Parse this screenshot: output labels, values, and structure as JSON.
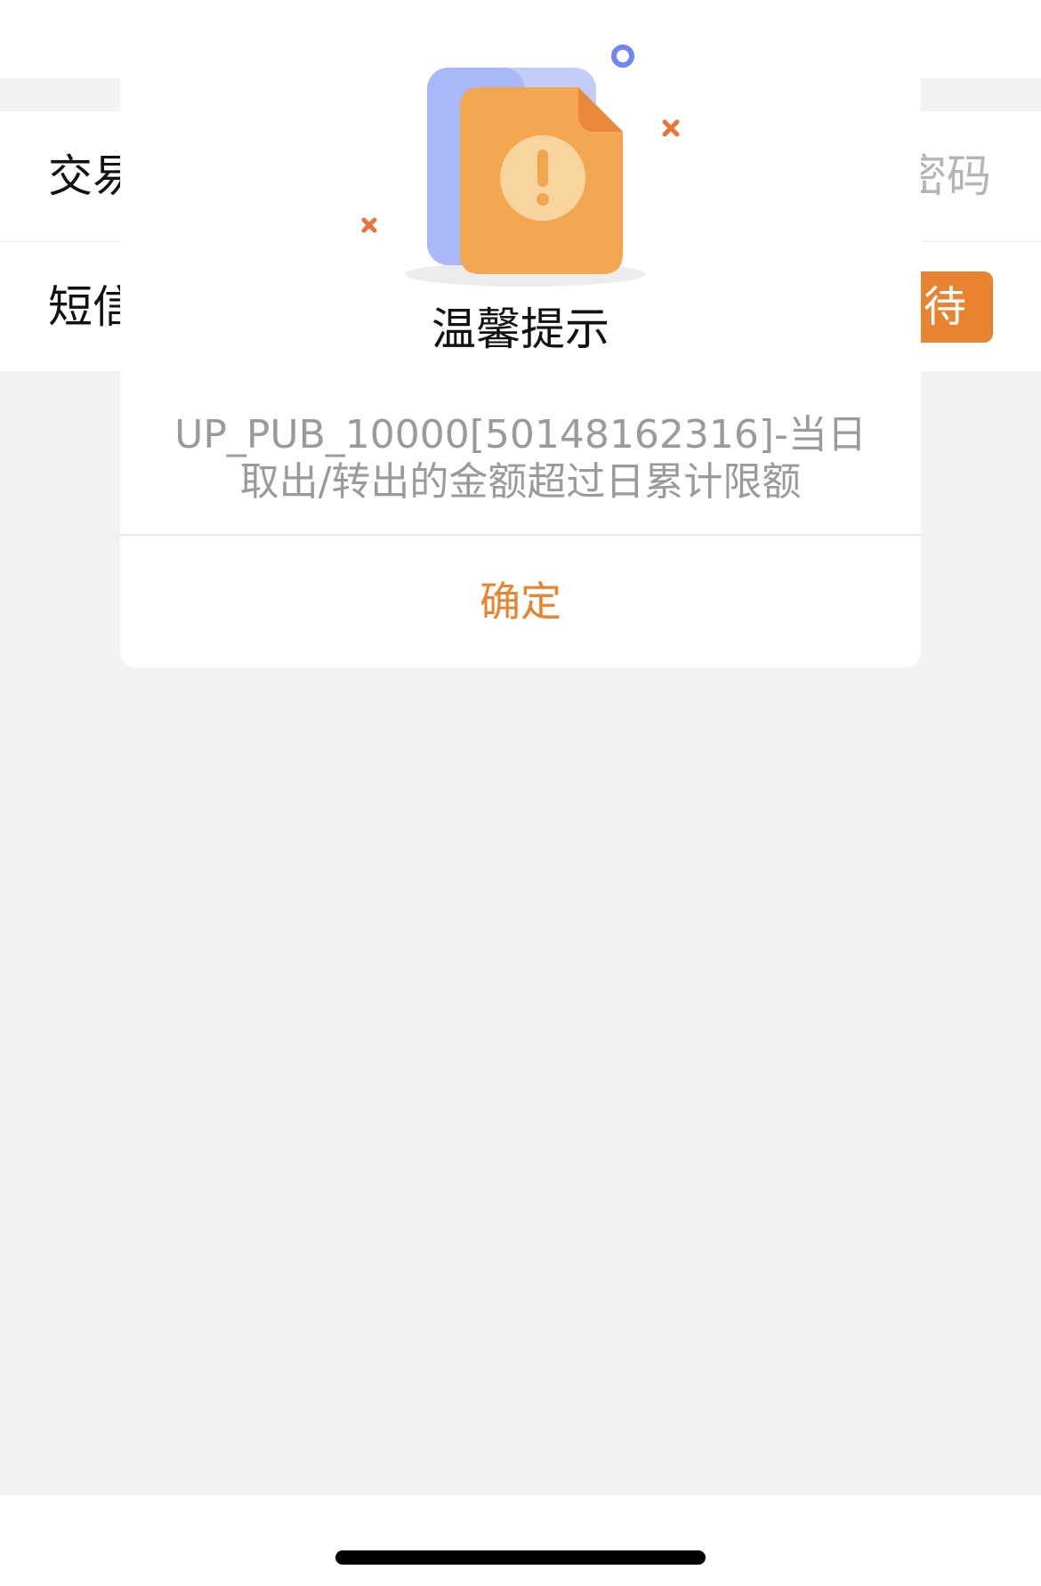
{
  "background_rows": {
    "row1_label": "交易",
    "row1_right": "密码",
    "row2_label": "短信",
    "row2_button": "待"
  },
  "dialog": {
    "title": "温馨提示",
    "message": "UP_PUB_10000[50148162316]-当日取出/转出的金额超过日累计限额",
    "confirm_label": "确定",
    "illustration_icon": "warning-document-icon"
  },
  "colors": {
    "accent": "#e8842f",
    "background": "#f2f2f2",
    "message_text": "#9a9a9a"
  }
}
